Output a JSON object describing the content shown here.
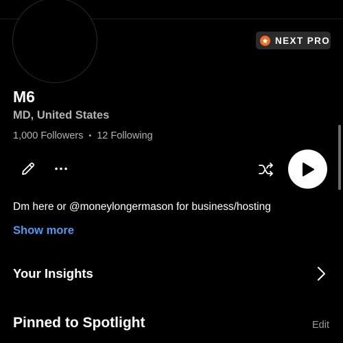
{
  "profile": {
    "name": "M6",
    "location": "MD, United States",
    "followers": "1,000 Followers",
    "separator": "•",
    "following": "12 Following",
    "bio": "Dm here or @moneylongermason for business/hosting",
    "show_more_label": "Show more"
  },
  "badge": {
    "label": "NEXT PRO",
    "icon": "star-icon",
    "color": "#f26b21"
  },
  "actions": {
    "edit_icon": "pencil-icon",
    "more_icon": "more-horizontal-icon",
    "shuffle_icon": "shuffle-icon",
    "play_icon": "play-icon"
  },
  "insights": {
    "label": "Your Insights",
    "icon": "chevron-right-icon"
  },
  "spotlight": {
    "title": "Pinned to Spotlight",
    "edit_label": "Edit"
  },
  "colors": {
    "background": "#000000",
    "link": "#4d9bf0",
    "secondary_text": "#b3b3b3",
    "badge_bg": "#2b2b2b"
  }
}
